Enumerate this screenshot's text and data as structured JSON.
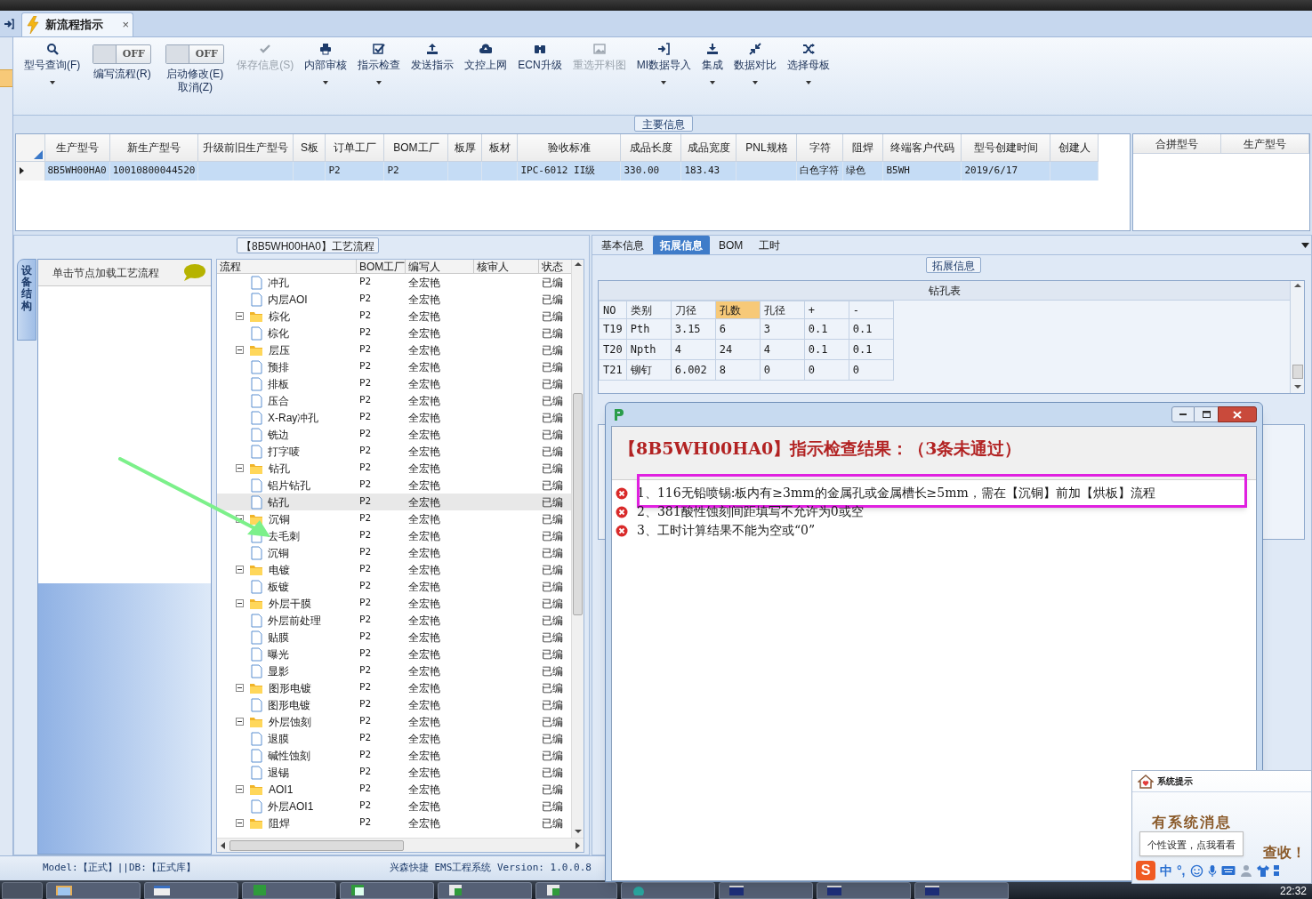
{
  "tab": {
    "title": "新流程指示",
    "close": "×"
  },
  "toolbar": [
    {
      "kind": "button",
      "label": "型号查询(F)",
      "disabled": false,
      "dropdown": true
    },
    {
      "kind": "toggle",
      "label": "编写流程(R)",
      "on": false,
      "switch_text": "OFF"
    },
    {
      "kind": "toggle",
      "label": "启动修改(E)",
      "label_2": "取消(Z)",
      "on": false,
      "switch_text": "OFF"
    },
    {
      "kind": "button",
      "label": "保存信息(S)",
      "disabled": true,
      "dropdown": false
    },
    {
      "kind": "button",
      "label": "内部审核",
      "disabled": false,
      "dropdown": true
    },
    {
      "kind": "button",
      "label": "指示检查",
      "disabled": false,
      "dropdown": true
    },
    {
      "kind": "button",
      "label": "发送指示",
      "disabled": false,
      "dropdown": false
    },
    {
      "kind": "button",
      "label": "文控上网",
      "disabled": false,
      "dropdown": false
    },
    {
      "kind": "button",
      "label": "ECN升级",
      "disabled": false,
      "dropdown": false
    },
    {
      "kind": "button",
      "label": "重选开料图",
      "disabled": true,
      "dropdown": false
    },
    {
      "kind": "button",
      "label": "MI数据导入",
      "disabled": false,
      "dropdown": true
    },
    {
      "kind": "button",
      "label": "集成",
      "disabled": false,
      "dropdown": true
    },
    {
      "kind": "button",
      "label": "数据对比",
      "disabled": false,
      "dropdown": true
    },
    {
      "kind": "button",
      "label": "选择母板",
      "disabled": false,
      "dropdown": true
    }
  ],
  "main_info": {
    "title": "主要信息",
    "columns": [
      "生产型号",
      "新生产型号",
      "升级前旧生产型号",
      "S板",
      "订单工厂",
      "BOM工厂",
      "板厚",
      "板材",
      "验收标准",
      "成品长度",
      "成品宽度",
      "PNL规格",
      "字符",
      "阻焊",
      "终端客户代码",
      "型号创建时间",
      "创建人"
    ],
    "rows": [
      {
        "selected": true,
        "cells": [
          "8B5WH00HA0",
          "10010800044520",
          null,
          null,
          "P2",
          "P2",
          null,
          null,
          "IPC-6012 II级",
          "330.00",
          "183.43",
          null,
          "白色字符",
          "绿色",
          "B5WH",
          "2019/6/17",
          null
        ]
      }
    ]
  },
  "merge_table": {
    "columns": [
      "合拼型号",
      "生产型号"
    ]
  },
  "process_panel": {
    "title": "【8B5WH00HA0】工艺流程",
    "side_tab": "设备结构",
    "hint": "单击节点加载工艺流程",
    "columns": [
      "流程",
      "BOM工厂",
      "编写人",
      "核审人",
      "状态"
    ],
    "tree": [
      {
        "kind": "step",
        "name": "冲孔",
        "bom": "P2",
        "writer": "全宏艳",
        "status": "已编",
        "selected": false
      },
      {
        "kind": "step",
        "name": "内层AOI",
        "bom": "P2",
        "writer": "全宏艳",
        "status": "已编",
        "selected": false
      },
      {
        "kind": "group",
        "name": "棕化",
        "bom": "P2",
        "writer": "全宏艳",
        "status": "已编",
        "selected": false,
        "expanded": true,
        "children": [
          {
            "kind": "step",
            "name": "棕化",
            "bom": "P2",
            "writer": "全宏艳",
            "status": "已编",
            "selected": false
          }
        ]
      },
      {
        "kind": "group",
        "name": "层压",
        "bom": "P2",
        "writer": "全宏艳",
        "status": "已编",
        "selected": false,
        "expanded": true,
        "children": [
          {
            "kind": "step",
            "name": "预排",
            "bom": "P2",
            "writer": "全宏艳",
            "status": "已编",
            "selected": false
          },
          {
            "kind": "step",
            "name": "排板",
            "bom": "P2",
            "writer": "全宏艳",
            "status": "已编",
            "selected": false
          },
          {
            "kind": "step",
            "name": "压合",
            "bom": "P2",
            "writer": "全宏艳",
            "status": "已编",
            "selected": false
          },
          {
            "kind": "step",
            "name": "X-Ray冲孔",
            "bom": "P2",
            "writer": "全宏艳",
            "status": "已编",
            "selected": false
          },
          {
            "kind": "step",
            "name": "铣边",
            "bom": "P2",
            "writer": "全宏艳",
            "status": "已编",
            "selected": false
          },
          {
            "kind": "step",
            "name": "打字唛",
            "bom": "P2",
            "writer": "全宏艳",
            "status": "已编",
            "selected": false
          }
        ]
      },
      {
        "kind": "group",
        "name": "钻孔",
        "bom": "P2",
        "writer": "全宏艳",
        "status": "已编",
        "selected": false,
        "expanded": true,
        "children": [
          {
            "kind": "step",
            "name": "铝片钻孔",
            "bom": "P2",
            "writer": "全宏艳",
            "status": "已编",
            "selected": false
          },
          {
            "kind": "step",
            "name": "钻孔",
            "bom": "P2",
            "writer": "全宏艳",
            "status": "已编",
            "selected": true
          }
        ]
      },
      {
        "kind": "group",
        "name": "沉铜",
        "bom": "P2",
        "writer": "全宏艳",
        "status": "已编",
        "selected": false,
        "expanded": true,
        "children": [
          {
            "kind": "step",
            "name": "去毛刺",
            "bom": "P2",
            "writer": "全宏艳",
            "status": "已编",
            "selected": false
          },
          {
            "kind": "step",
            "name": "沉铜",
            "bom": "P2",
            "writer": "全宏艳",
            "status": "已编",
            "selected": false
          }
        ]
      },
      {
        "kind": "group",
        "name": "电镀",
        "bom": "P2",
        "writer": "全宏艳",
        "status": "已编",
        "selected": false,
        "expanded": true,
        "children": [
          {
            "kind": "step",
            "name": "板镀",
            "bom": "P2",
            "writer": "全宏艳",
            "status": "已编",
            "selected": false
          }
        ]
      },
      {
        "kind": "group",
        "name": "外层干膜",
        "bom": "P2",
        "writer": "全宏艳",
        "status": "已编",
        "selected": false,
        "expanded": true,
        "children": [
          {
            "kind": "step",
            "name": "外层前处理",
            "bom": "P2",
            "writer": "全宏艳",
            "status": "已编",
            "selected": false
          },
          {
            "kind": "step",
            "name": "贴膜",
            "bom": "P2",
            "writer": "全宏艳",
            "status": "已编",
            "selected": false
          },
          {
            "kind": "step",
            "name": "曝光",
            "bom": "P2",
            "writer": "全宏艳",
            "status": "已编",
            "selected": false
          },
          {
            "kind": "step",
            "name": "显影",
            "bom": "P2",
            "writer": "全宏艳",
            "status": "已编",
            "selected": false
          }
        ]
      },
      {
        "kind": "group",
        "name": "图形电镀",
        "bom": "P2",
        "writer": "全宏艳",
        "status": "已编",
        "selected": false,
        "expanded": true,
        "children": [
          {
            "kind": "step",
            "name": "图形电镀",
            "bom": "P2",
            "writer": "全宏艳",
            "status": "已编",
            "selected": false
          }
        ]
      },
      {
        "kind": "group",
        "name": "外层蚀刻",
        "bom": "P2",
        "writer": "全宏艳",
        "status": "已编",
        "selected": false,
        "expanded": true,
        "children": [
          {
            "kind": "step",
            "name": "退膜",
            "bom": "P2",
            "writer": "全宏艳",
            "status": "已编",
            "selected": false
          },
          {
            "kind": "step",
            "name": "碱性蚀刻",
            "bom": "P2",
            "writer": "全宏艳",
            "status": "已编",
            "selected": false
          },
          {
            "kind": "step",
            "name": "退锡",
            "bom": "P2",
            "writer": "全宏艳",
            "status": "已编",
            "selected": false
          }
        ]
      },
      {
        "kind": "group",
        "name": "AOI1",
        "bom": "P2",
        "writer": "全宏艳",
        "status": "已编",
        "selected": false,
        "expanded": true,
        "children": [
          {
            "kind": "step",
            "name": "外层AOI1",
            "bom": "P2",
            "writer": "全宏艳",
            "status": "已编",
            "selected": false
          }
        ]
      },
      {
        "kind": "group",
        "name": "阻焊",
        "bom": "P2",
        "writer": "全宏艳",
        "status": "已编",
        "selected": false,
        "expanded": true
      }
    ]
  },
  "detail_panel": {
    "tabs": [
      {
        "label": "基本信息",
        "selected": false
      },
      {
        "label": "拓展信息",
        "selected": true
      },
      {
        "label": "BOM",
        "selected": false
      },
      {
        "label": "工时",
        "selected": false
      }
    ],
    "group_title": "拓展信息",
    "drill_table": {
      "title": "钻孔表",
      "columns": [
        {
          "label": "NO",
          "sorted": false
        },
        {
          "label": "类别",
          "sorted": false
        },
        {
          "label": "刀径",
          "sorted": false
        },
        {
          "label": "孔数",
          "sorted": true
        },
        {
          "label": "孔径",
          "sorted": false
        },
        {
          "label": "+",
          "sorted": false
        },
        {
          "label": "-",
          "sorted": false
        }
      ],
      "rows": [
        [
          "T19",
          "Pth",
          "3.15",
          "6",
          "3",
          "0.1",
          "0.1"
        ],
        [
          "T20",
          "Npth",
          "4",
          "24",
          "4",
          "0.1",
          "0.1"
        ],
        [
          "T21",
          "铆钉",
          "6.002",
          "8",
          "0",
          "0",
          "0"
        ]
      ]
    }
  },
  "dialog": {
    "heading": "【8B5WH00HA0】指示检查结果：（3条未通过）",
    "errors": [
      {
        "text": "1、116无铅喷锡:板内有≥3mm的金属孔或金属槽长≥5mm，需在【沉铜】前加【烘板】流程",
        "highlighted": true
      },
      {
        "text": "2、381酸性蚀刻间距填写不允许为0或空",
        "highlighted": false
      },
      {
        "text": "3、工时计算结果不能为空或“0”",
        "highlighted": false
      }
    ]
  },
  "status_bar": {
    "left": "Model:【正式】||DB:【正式库】",
    "right": "兴森快捷 EMS工程系统 Version: 1.0.0.8"
  },
  "notification": {
    "title": "系统提示",
    "message": "有系统消息",
    "message_2": "查收！",
    "tooltip": "个性设置，点我看看",
    "ime_logo": "S",
    "ime_items": [
      "中",
      "°,"
    ]
  },
  "taskbar": {
    "clock": "22:32"
  }
}
